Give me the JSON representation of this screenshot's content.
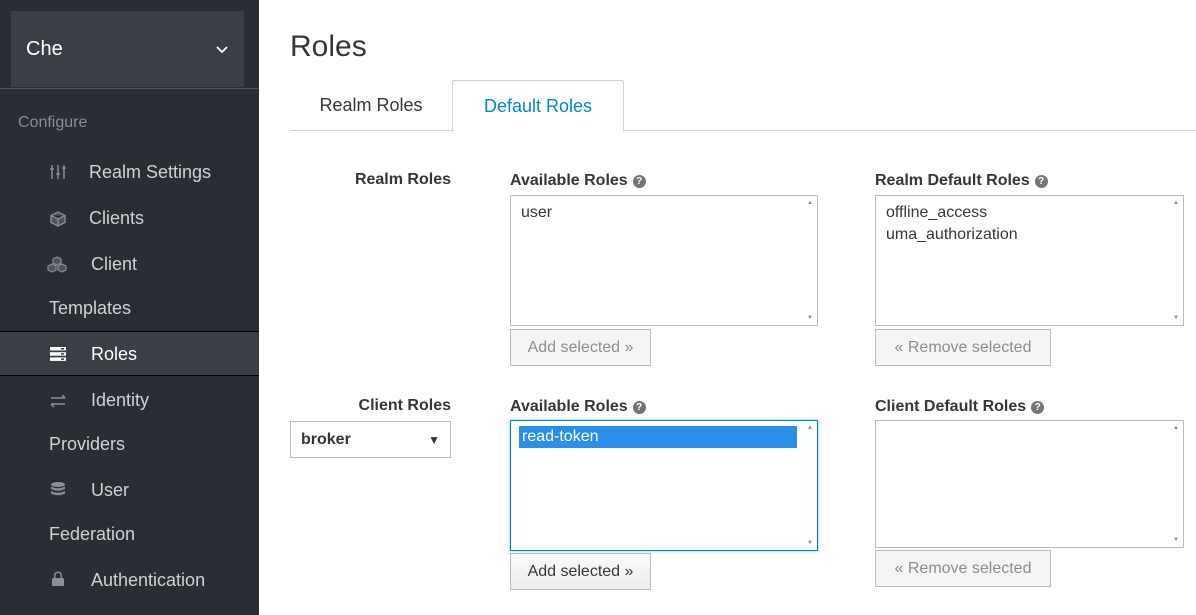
{
  "sidebar": {
    "realm": "Che",
    "section_label": "Configure",
    "items": [
      {
        "label_1": "Realm Settings",
        "label_2": "",
        "icon": "sliders-icon"
      },
      {
        "label_1": "Clients",
        "label_2": "",
        "icon": "cube-icon"
      },
      {
        "label_1": "Client",
        "label_2": "Templates",
        "icon": "cubes-icon"
      },
      {
        "label_1": "Roles",
        "label_2": "",
        "icon": "list-icon",
        "active": true
      },
      {
        "label_1": "Identity",
        "label_2": "Providers",
        "icon": "exchange-icon"
      },
      {
        "label_1": "User",
        "label_2": "Federation",
        "icon": "database-icon"
      },
      {
        "label_1": "Authentication",
        "label_2": "",
        "icon": "lock-icon"
      }
    ]
  },
  "page": {
    "title": "Roles"
  },
  "tabs": [
    {
      "label": "Realm Roles",
      "active": false
    },
    {
      "label": "Default Roles",
      "active": true
    }
  ],
  "realm_section": {
    "row_label": "Realm Roles",
    "available_label": "Available Roles",
    "available_items": [
      "user"
    ],
    "default_label": "Realm Default Roles",
    "default_items": [
      "offline_access",
      "uma_authorization"
    ],
    "add_button": "Add selected »",
    "remove_button": "« Remove selected"
  },
  "client_section": {
    "row_label": "Client Roles",
    "client_select": "broker",
    "available_label": "Available Roles",
    "available_items": [
      "read-token"
    ],
    "selected_item": "read-token",
    "default_label": "Client Default Roles",
    "default_items": [],
    "add_button": "Add selected »",
    "remove_button": "« Remove selected"
  },
  "colors": {
    "accent": "#0088ce",
    "sidebar_bg": "#292e34",
    "selection": "#2a8fe8"
  }
}
